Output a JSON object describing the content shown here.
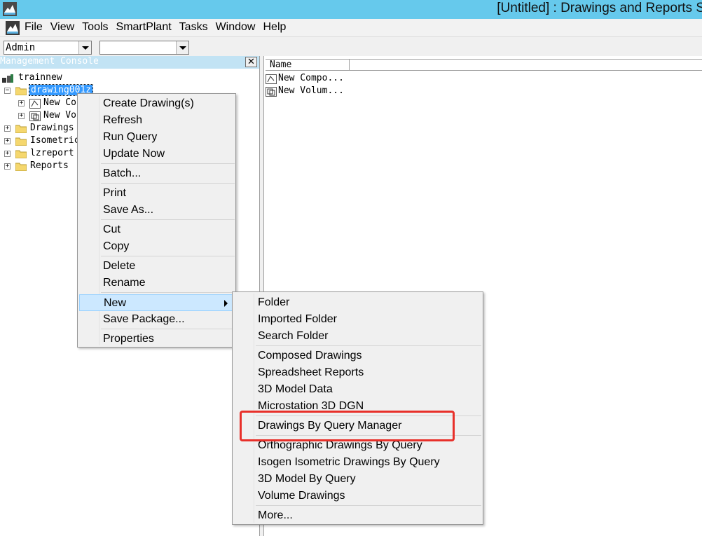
{
  "window": {
    "title": "[Untitled] : Drawings and Reports S"
  },
  "menubar": {
    "items": [
      "File",
      "View",
      "Tools",
      "SmartPlant",
      "Tasks",
      "Window",
      "Help"
    ]
  },
  "toolbar": {
    "user_combo_value": "Admin",
    "second_combo_value": ""
  },
  "console": {
    "title": "Management Console",
    "close_glyph": "✕",
    "tree": {
      "root": "trainnew",
      "selected": "drawing001z",
      "children_of_selected": [
        "New Co",
        "New Vo"
      ],
      "siblings": [
        "Drawings",
        "Isometric",
        "lzreport",
        "Reports"
      ]
    }
  },
  "list": {
    "column_name": "Name",
    "rows": [
      "New Compo...",
      "New Volum..."
    ]
  },
  "context_menu": {
    "items": [
      "Create Drawing(s)",
      "Refresh",
      "Run Query",
      "Update Now",
      "Batch...",
      "Print",
      "Save As...",
      "Cut",
      "Copy",
      "Delete",
      "Rename",
      "New",
      "Save Package...",
      "Properties"
    ],
    "highlighted": "New"
  },
  "submenu": {
    "items": [
      "Folder",
      "Imported Folder",
      "Search Folder",
      "Composed Drawings",
      "Spreadsheet Reports",
      "3D Model Data",
      "Microstation 3D DGN",
      "Drawings By Query Manager",
      "Orthographic Drawings By Query",
      "Isogen Isometric Drawings By Query",
      "3D Model By Query",
      "Volume Drawings",
      "More..."
    ],
    "annotated": "Drawings By Query Manager",
    "annotation_color": "#e8302a"
  },
  "colors": {
    "titlebar": "#66c9ec",
    "selection": "#3399ff",
    "menu_highlight": "#cce8ff"
  }
}
